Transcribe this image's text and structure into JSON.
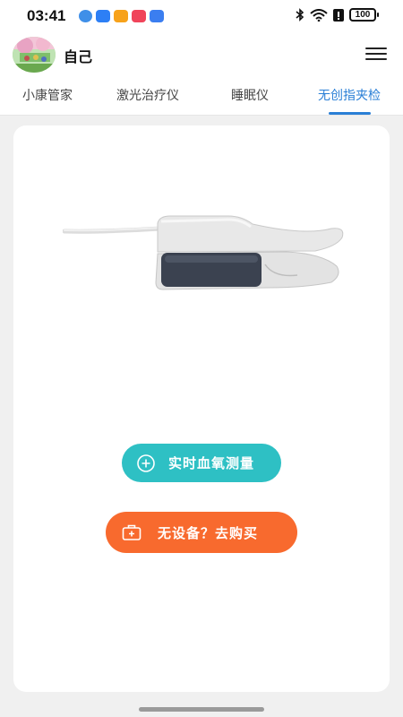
{
  "status_bar": {
    "time": "03:41",
    "battery": "100"
  },
  "header": {
    "user_name": "自己"
  },
  "tabs": [
    {
      "label": "小康管家",
      "active": false
    },
    {
      "label": "激光治疗仪",
      "active": false
    },
    {
      "label": "睡眠仪",
      "active": false
    },
    {
      "label": "无创指夹检",
      "active": true
    }
  ],
  "card": {
    "measure_button": "实时血氧测量",
    "buy_button": "无设备？去购买"
  },
  "colors": {
    "accent_blue": "#2a7fd6",
    "measure_teal": "#2ec0c4",
    "buy_orange": "#f86a2e"
  }
}
